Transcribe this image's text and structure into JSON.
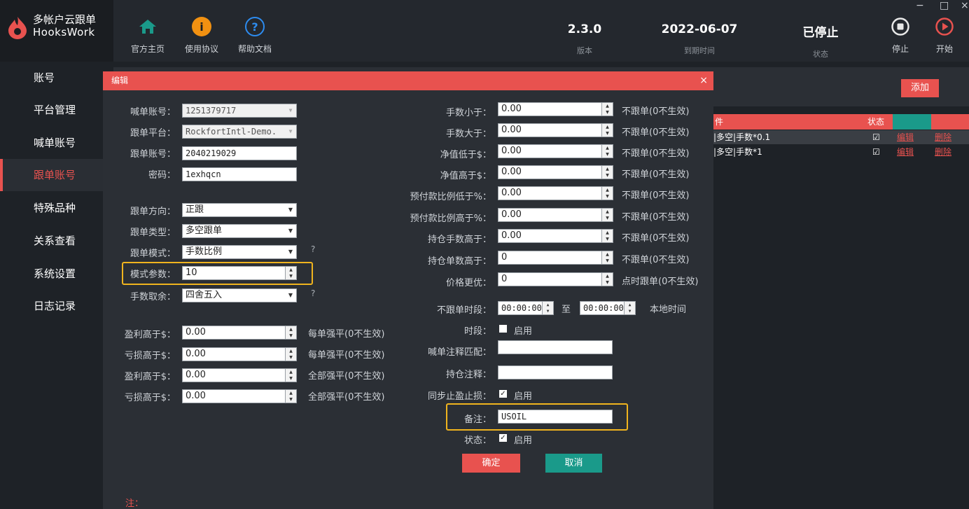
{
  "app": {
    "title": "多帐户云跟单",
    "subtitle": "HooksWork",
    "window_controls": [
      "−",
      "□",
      "×"
    ]
  },
  "topnav": {
    "home": {
      "label": "官方主页",
      "icon": "home-icon"
    },
    "agreement": {
      "label": "使用协议",
      "icon": "info-icon"
    },
    "help": {
      "label": "帮助文档",
      "icon": "question-icon"
    },
    "version": {
      "value": "2.3.0",
      "label": "版本"
    },
    "expiry": {
      "value": "2022-06-07",
      "label": "到期时间"
    },
    "status": {
      "value": "已停止",
      "label": "状态"
    },
    "stop": {
      "label": "停止",
      "icon": "stop-icon"
    },
    "start": {
      "label": "开始",
      "icon": "play-icon"
    }
  },
  "sidebar": {
    "items": [
      {
        "label": "账号"
      },
      {
        "label": "平台管理"
      },
      {
        "label": "喊单账号"
      },
      {
        "label": "跟单账号",
        "active": true
      },
      {
        "label": "特殊品种"
      },
      {
        "label": "关系查看"
      },
      {
        "label": "系统设置"
      },
      {
        "label": "日志记录"
      }
    ]
  },
  "background": {
    "add_label": "添加",
    "table_header_partial": "件",
    "status_col": "状态",
    "rows": [
      {
        "text": "|多空|手数*0.1",
        "check": "☑",
        "edit": "编辑",
        "delete": "删除"
      },
      {
        "text": "|多空|手数*1",
        "check": "☑",
        "edit": "编辑",
        "delete": "删除"
      }
    ]
  },
  "dialog": {
    "title": "编辑",
    "close": "×",
    "left": {
      "signal_account": {
        "label": "喊单账号：",
        "value": "1251379717"
      },
      "follow_platform": {
        "label": "跟单平台：",
        "value": "RockfortIntl-Demo."
      },
      "follow_account": {
        "label": "跟单账号：",
        "value": "2040219029"
      },
      "password": {
        "label": "密码：",
        "value": "1exhqcn"
      },
      "direction": {
        "label": "跟单方向：",
        "value": "正跟"
      },
      "type": {
        "label": "跟单类型：",
        "value": "多空跟单"
      },
      "mode": {
        "label": "跟单模式：",
        "value": "手数比例"
      },
      "mode_param": {
        "label": "模式参数：",
        "value": "10"
      },
      "rounding": {
        "label": "手数取余：",
        "value": "四舍五入"
      },
      "q": "?",
      "pnl": [
        {
          "label": "盈利高于$：",
          "value": "0.00",
          "hint": "每单强平(0不生效)"
        },
        {
          "label": "亏损高于$：",
          "value": "0.00",
          "hint": "每单强平(0不生效)"
        },
        {
          "label": "盈利高于$：",
          "value": "0.00",
          "hint": "全部强平(0不生效)"
        },
        {
          "label": "亏损高于$：",
          "value": "0.00",
          "hint": "全部强平(0不生效)"
        }
      ]
    },
    "right": {
      "filters": [
        {
          "label": "手数小于：",
          "value": "0.00",
          "hint": "不跟单(0不生效)"
        },
        {
          "label": "手数大于：",
          "value": "0.00",
          "hint": "不跟单(0不生效)"
        },
        {
          "label": "净值低于$：",
          "value": "0.00",
          "hint": "不跟单(0不生效)"
        },
        {
          "label": "净值高于$：",
          "value": "0.00",
          "hint": "不跟单(0不生效)"
        },
        {
          "label": "预付款比例低于%：",
          "value": "0.00",
          "hint": "不跟单(0不生效)"
        },
        {
          "label": "预付款比例高于%：",
          "value": "0.00",
          "hint": "不跟单(0不生效)"
        },
        {
          "label": "持仓手数高于：",
          "value": "0.00",
          "hint": "不跟单(0不生效)"
        },
        {
          "label": "持仓单数高于：",
          "value": "0",
          "hint": "不跟单(0不生效)"
        },
        {
          "label": "价格更优：",
          "value": "0",
          "hint": "点时跟单(0不生效)"
        }
      ],
      "no_follow_period": {
        "label": "不跟单时段：",
        "from": "00:00:00",
        "to_label": "至",
        "to": "00:00:00",
        "suffix": "本地时间"
      },
      "period": {
        "label": "时段：",
        "check_label": "启用",
        "checked": false
      },
      "signal_comment": {
        "label": "喊单注释匹配：",
        "value": ""
      },
      "position_comment": {
        "label": "持仓注释：",
        "value": ""
      },
      "sync_sltp": {
        "label": "同步止盈止损：",
        "check_label": "启用",
        "checked": true
      },
      "remark": {
        "label": "备注：",
        "value": "USOIL"
      },
      "status": {
        "label": "状态：",
        "check_label": "启用",
        "checked": true
      }
    },
    "ok_label": "确定",
    "cancel_label": "取消",
    "note": "注："
  },
  "colors": {
    "accent": "#e8524f",
    "teal": "#1a9a8a",
    "highlight": "#f0b41e",
    "bg": "#1e2227",
    "panel": "#2b2f35"
  }
}
